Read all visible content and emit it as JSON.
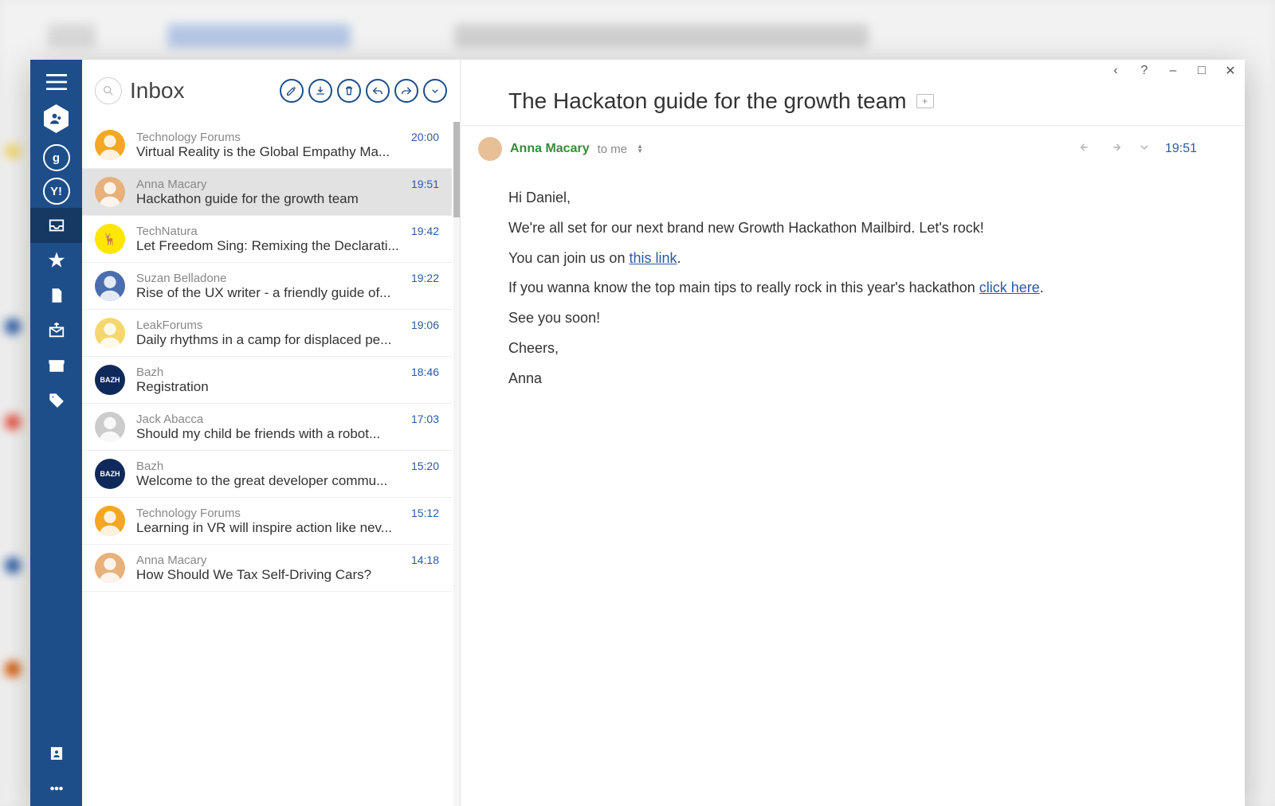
{
  "folder_title": "Inbox",
  "window": {
    "back": "‹",
    "help": "?",
    "min": "–",
    "max": "□",
    "close": "✕"
  },
  "sidebar": {
    "accounts": {
      "google": "g",
      "yahoo": "Y!"
    }
  },
  "emails": [
    {
      "sender": "Technology Forums",
      "subject": "Virtual Reality is the Global Empathy Ma...",
      "time": "20:00",
      "avatar_bg": "#f5a623",
      "avatar_face": true
    },
    {
      "sender": "Anna Macary",
      "subject": "Hackathon guide for the growth team",
      "time": "19:51",
      "avatar_bg": "#e8b07a",
      "avatar_face": true,
      "selected": true
    },
    {
      "sender": "TechNatura",
      "subject": "Let Freedom Sing: Remixing the Declarati...",
      "time": "19:42",
      "avatar_bg": "#ffe600",
      "avatar_text": "🦌"
    },
    {
      "sender": "Suzan Belladone",
      "subject": "Rise of the UX writer - a friendly guide of...",
      "time": "19:22",
      "avatar_bg": "#4a6db0",
      "avatar_face": true
    },
    {
      "sender": "LeakForums",
      "subject": "Daily rhythms in a camp for displaced pe...",
      "time": "19:06",
      "avatar_bg": "#f5d76e",
      "avatar_face": true
    },
    {
      "sender": "Bazh",
      "subject": "Registration",
      "time": "18:46",
      "avatar_bg": "#0f2a5a",
      "avatar_text": "BAZH"
    },
    {
      "sender": "Jack Abacca",
      "subject": "Should my child be friends with a robot...",
      "time": "17:03",
      "avatar_bg": "#cccccc",
      "avatar_face": true
    },
    {
      "sender": "Bazh",
      "subject": "Welcome to the great developer commu...",
      "time": "15:20",
      "avatar_bg": "#0f2a5a",
      "avatar_text": "BAZH"
    },
    {
      "sender": "Technology Forums",
      "subject": "Learning in VR will inspire action like nev...",
      "time": "15:12",
      "avatar_bg": "#f5a623",
      "avatar_face": true
    },
    {
      "sender": "Anna Macary",
      "subject": "How Should We Tax Self-Driving Cars?",
      "time": "14:18",
      "avatar_bg": "#e8b07a",
      "avatar_face": true
    }
  ],
  "message": {
    "title": "The Hackaton guide for the growth team",
    "from": "Anna Macary",
    "to": "to me",
    "time": "19:51",
    "body": {
      "p1": "Hi Daniel,",
      "p2": "We're all set for our next brand new Growth Hackathon Mailbird. Let's rock!",
      "p3a": "You can join us on ",
      "p3link": "this link",
      "p3b": ".",
      "p4a": "If you wanna know the top main tips to really rock in this year's hackathon ",
      "p4link": "click here",
      "p4b": ".",
      "p5": "See you soon!",
      "p6": "Cheers,",
      "p7": "Anna"
    }
  }
}
